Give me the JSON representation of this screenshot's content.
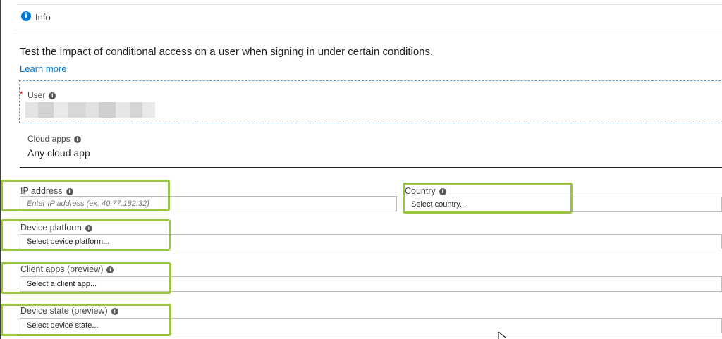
{
  "info": {
    "label": "Info"
  },
  "description": "Test the impact of conditional access on a user when signing in under certain conditions.",
  "learn_more": "Learn more",
  "user": {
    "label": "User",
    "required_marker": "*"
  },
  "cloud_apps": {
    "label": "Cloud apps",
    "value": "Any cloud app"
  },
  "ip_address": {
    "label": "IP address",
    "placeholder": "Enter IP address (ex: 40.77.182.32)"
  },
  "country": {
    "label": "Country",
    "value": "Select country..."
  },
  "device_platform": {
    "label": "Device platform",
    "value": "Select device platform..."
  },
  "client_apps": {
    "label": "Client apps (preview)",
    "value": "Select a client app..."
  },
  "device_state": {
    "label": "Device state (preview)",
    "value": "Select device state..."
  },
  "colors": {
    "accent": "#0078d4",
    "highlight": "#9bc443",
    "required": "#e81123"
  },
  "icons": [
    "info-icon",
    "info-dot-icon",
    "mouse-cursor-icon"
  ]
}
